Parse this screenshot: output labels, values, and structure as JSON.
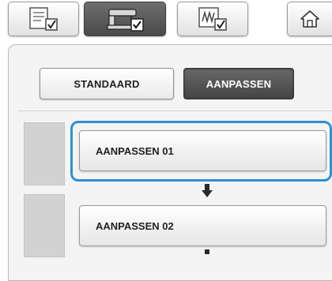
{
  "tabs": [
    {
      "id": "pattern-tab",
      "icon": "pattern-document-check-icon"
    },
    {
      "id": "machine-tab",
      "icon": "sewing-machine-check-icon",
      "active": true
    },
    {
      "id": "embroidery-tab",
      "icon": "embroidery-frame-check-icon"
    },
    {
      "id": "home",
      "icon": "home-icon"
    }
  ],
  "mode": {
    "standard_label": "STANDAARD",
    "custom_label": "AANPASSEN"
  },
  "custom_list": [
    {
      "label": "AANPASSEN 01",
      "selected": true
    },
    {
      "label": "AANPASSEN 02",
      "selected": false
    }
  ],
  "colors": {
    "accent": "#2d8fd8",
    "active_button": "#555555"
  }
}
